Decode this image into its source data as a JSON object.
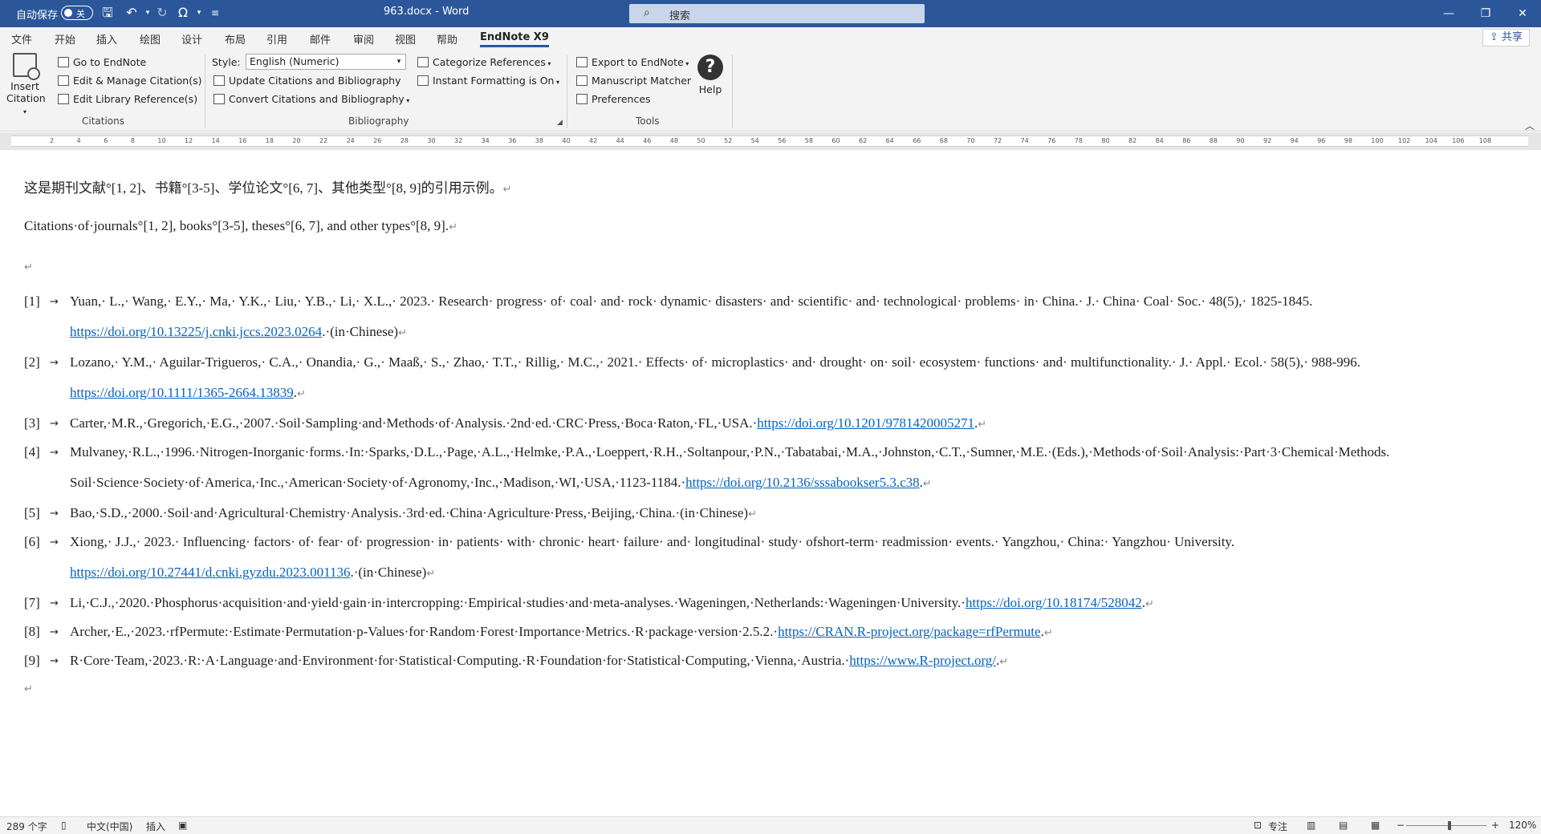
{
  "titlebar": {
    "autosave_label": "自动保存",
    "autosave_state": "关",
    "doc_title": "963.docx  -  Word",
    "search_placeholder": "搜索"
  },
  "tabs": [
    "文件",
    "开始",
    "插入",
    "绘图",
    "设计",
    "布局",
    "引用",
    "邮件",
    "审阅",
    "视图",
    "帮助",
    "EndNote X9"
  ],
  "share_label": "共享",
  "ribbon": {
    "citations": {
      "insert_label_1": "Insert",
      "insert_label_2": "Citation",
      "go_to": "Go to EndNote",
      "edit_manage": "Edit & Manage Citation(s)",
      "edit_library": "Edit Library Reference(s)",
      "group_label": "Citations"
    },
    "bibliography": {
      "style_label": "Style:",
      "style_value": "English (Numeric)",
      "update": "Update Citations and Bibliography",
      "convert": "Convert Citations and Bibliography",
      "categorize": "Categorize References",
      "instant": "Instant Formatting is On",
      "group_label": "Bibliography"
    },
    "tools": {
      "export": "Export to EndNote",
      "matcher": "Manuscript Matcher",
      "preferences": "Preferences",
      "help": "Help",
      "group_label": "Tools"
    }
  },
  "ruler_ticks": [
    "2",
    "4",
    "6",
    "8",
    "10",
    "12",
    "14",
    "16",
    "18",
    "20",
    "22",
    "24",
    "26",
    "28",
    "30",
    "32",
    "34",
    "36",
    "38",
    "40",
    "42",
    "44",
    "46",
    "48",
    "50",
    "52",
    "54",
    "56",
    "58",
    "60",
    "62",
    "64",
    "66",
    "68",
    "70",
    "72",
    "74",
    "76",
    "78",
    "80",
    "82",
    "84",
    "86",
    "88",
    "90",
    "92",
    "94",
    "96",
    "98",
    "100",
    "102",
    "104",
    "106",
    "108"
  ],
  "document": {
    "line_cn": "这是期刊文献°[1, 2]、书籍°[3-5]、学位论文°[6, 7]、其他类型°[8, 9]的引用示例。",
    "line_en": "Citations·of·journals°[1, 2], books°[3-5], theses°[6, 7], and other types°[8, 9].",
    "para_mark": "↵",
    "references": [
      {
        "num": "[1]",
        "line1": "Yuan,· L.,· Wang,· E.Y.,· Ma,· Y.K.,· Liu,· Y.B.,· Li,· X.L.,· 2023.· Research· progress· of· coal· and· rock· dynamic· disasters· and· scientific· and· technological· problems· in· China.· J.· China· Coal· Soc.· 48(5),· 1825-1845.",
        "link": "https://doi.org/10.13225/j.cnki.jccs.2023.0264",
        "tail": ".·(in·Chinese)"
      },
      {
        "num": "[2]",
        "line1": "Lozano,· Y.M.,· Aguilar-Trigueros,· C.A.,· Onandia,· G.,· Maaß,· S.,· Zhao,· T.T.,· Rillig,· M.C.,· 2021.· Effects· of· microplastics· and· drought· on· soil· ecosystem· functions· and· multifunctionality.· J.· Appl.· Ecol.· 58(5),· 988-996.",
        "link": "https://doi.org/10.1111/1365-2664.13839",
        "tail": "."
      },
      {
        "num": "[3]",
        "text": "Carter,·M.R.,·Gregorich,·E.G.,·2007.·Soil·Sampling·and·Methods·of·Analysis.·2nd·ed.·CRC·Press,·Boca·Raton,·FL,·USA.·",
        "link": "https://doi.org/10.1201/9781420005271",
        "tail": "."
      },
      {
        "num": "[4]",
        "line1": "Mulvaney,·R.L.,·1996.·Nitrogen-Inorganic·forms.·In:·Sparks,·D.L.,·Page,·A.L.,·Helmke,·P.A.,·Loeppert,·R.H.,·Soltanpour,·P.N.,·Tabatabai,·M.A.,·Johnston,·C.T.,·Sumner,·M.E.·(Eds.),·Methods·of·Soil·Analysis:·Part·3·Chemical·Methods.",
        "line2": "Soil·Science·Society·of·America,·Inc.,·American·Society·of·Agronomy,·Inc.,·Madison,·WI,·USA,·1123-1184.·",
        "link": "https://doi.org/10.2136/sssabookser5.3.c38",
        "tail": "."
      },
      {
        "num": "[5]",
        "text": "Bao,·S.D.,·2000.·Soil·and·Agricultural·Chemistry·Analysis.·3rd·ed.·China·Agriculture·Press,·Beijing,·China.·(in·Chinese)"
      },
      {
        "num": "[6]",
        "line1": "Xiong,·  J.J.,·  2023.·  Influencing·  factors·  of·  fear·  of·  progression·  in·  patients·  with·  chronic·  heart·  failure·  and·  longitudinal·  study·  ofshort-term·  readmission·  events.·  Yangzhou,·  China:·  Yangzhou·  University.",
        "link": "https://doi.org/10.27441/d.cnki.gyzdu.2023.001136",
        "tail": ".·(in·Chinese)"
      },
      {
        "num": "[7]",
        "text": "Li,·C.J.,·2020.·Phosphorus·acquisition·and·yield·gain·in·intercropping:·Empirical·studies·and·meta-analyses.·Wageningen,·Netherlands:·Wageningen·University.·",
        "link": "https://doi.org/10.18174/528042",
        "tail": "."
      },
      {
        "num": "[8]",
        "text": "Archer,·E.,·2023.·rfPermute:·Estimate·Permutation·p-Values·for·Random·Forest·Importance·Metrics.·R·package·version·2.5.2.·",
        "link": "https://CRAN.R-project.org/package=rfPermute",
        "tail": "."
      },
      {
        "num": "[9]",
        "text": "R·Core·Team,·2023.·R:·A·Language·and·Environment·for·Statistical·Computing.·R·Foundation·for·Statistical·Computing,·Vienna,·Austria.·",
        "link": "https://www.R-project.org/",
        "tail": "."
      }
    ]
  },
  "status": {
    "word_count": "289 个字",
    "language": "中文(中国)",
    "mode": "插入",
    "focus": "专注",
    "zoom": "120%"
  }
}
